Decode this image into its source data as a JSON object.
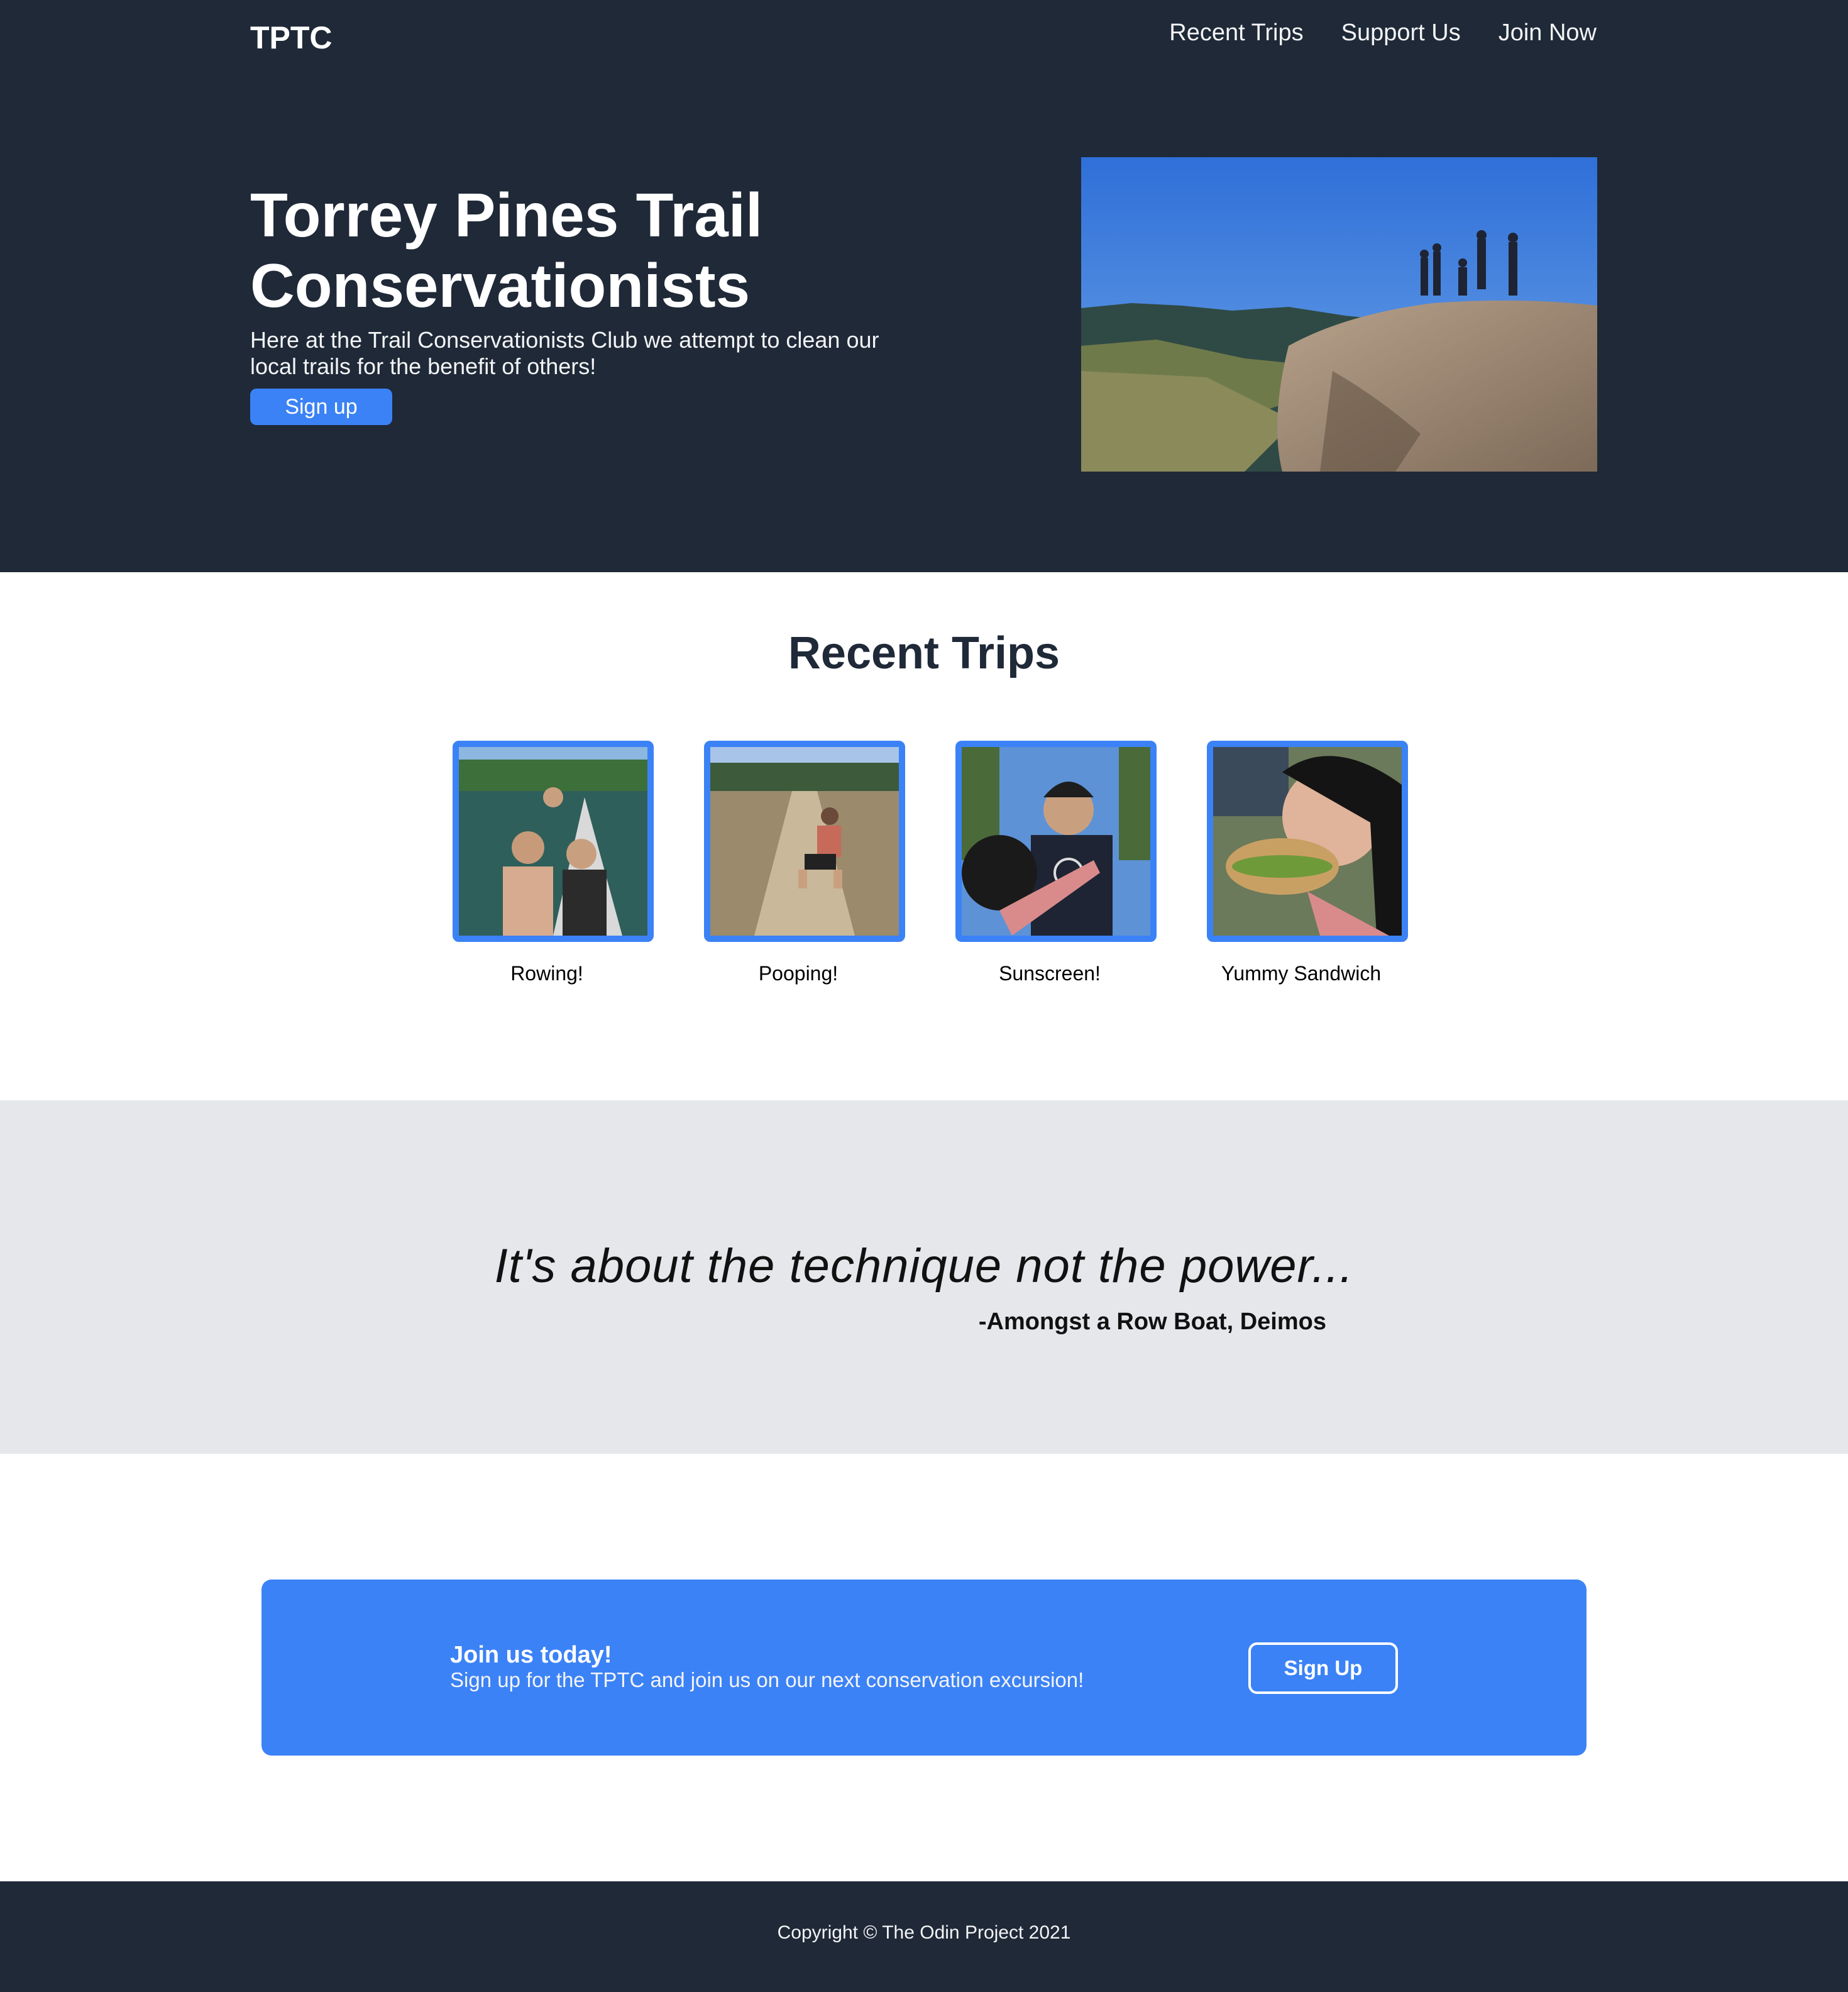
{
  "header": {
    "logo": "TPTC",
    "nav": [
      "Recent Trips",
      "Support Us",
      "Join Now"
    ]
  },
  "hero": {
    "title": "Torrey Pines Trail Conservationists",
    "text": "Here at the Trail Conservationists Club we attempt to clean our local trails for the benefit of others!",
    "button": "Sign up"
  },
  "trips": {
    "title": "Recent Trips",
    "items": [
      {
        "caption": "Rowing!"
      },
      {
        "caption": "Pooping!"
      },
      {
        "caption": "Sunscreen!"
      },
      {
        "caption": "Yummy Sandwich"
      }
    ]
  },
  "quote": {
    "text": "It's about the technique not the power...",
    "author": "-Amongst a Row Boat, Deimos"
  },
  "cta": {
    "title": "Join us today!",
    "text": "Sign up for the TPTC and join us on our next conservation excursion!",
    "button": "Sign Up"
  },
  "footer": {
    "copyright": "Copyright © The Odin Project 2021"
  },
  "colors": {
    "dark": "#1f2937",
    "accent": "#3b82f6",
    "quote_band": "#e5e7eb"
  }
}
